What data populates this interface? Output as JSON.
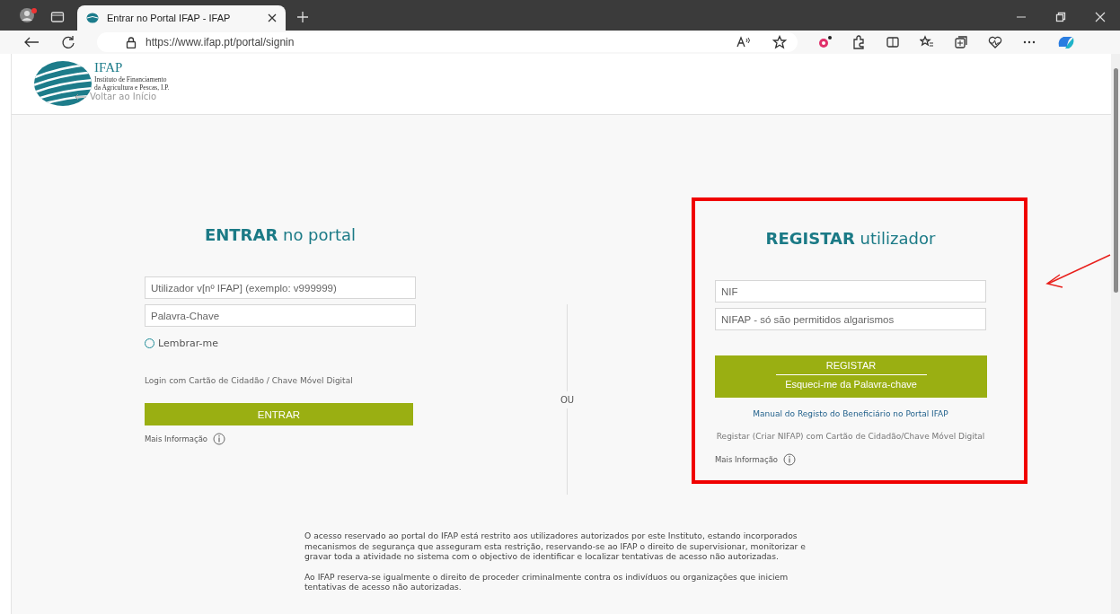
{
  "browser": {
    "tabs": [
      {
        "title": "Entrar no Portal IFAP - IFAP",
        "selected": true
      }
    ],
    "url": "https://www.ifap.pt/portal/signin"
  },
  "header": {
    "logo_title": "IFAP",
    "logo_subtitle": [
      "Instituto de Financiamento",
      "da Agricultura e Pescas, I.P."
    ],
    "back_link": "Voltar ao Início"
  },
  "login": {
    "title": "**ENTRAR** no portal",
    "fields": [
      {
        "placeholder": "Utilizador v[nº IFAP] (exemplo: v999999)"
      },
      {
        "placeholder": "Palavra-Chave"
      }
    ],
    "remember": {
      "label": "Lembrar-me",
      "checked": false
    },
    "citizen_card_link": "Login com Cartão de Cidadão / Chave Móvel Digital",
    "submit": "ENTRAR",
    "more_info": "Mais Informação"
  },
  "separator": "OU",
  "register": {
    "title": "**REGISTAR** utilizador",
    "fields": [
      {
        "placeholder": "NIF"
      },
      {
        "placeholder": "NIFAP - só são permitidos algarismos"
      }
    ],
    "buttons": [
      "REGISTAR",
      "Esqueci-me da Palavra-chave"
    ],
    "manual_link": "Manual do Registo do Beneficiário no Portal IFAP",
    "citizen_card_link": "Registar (Criar NIFAP) com Cartão de Cidadão/Chave Móvel Digital",
    "more_info": "Mais Informação"
  },
  "notice": [
    "O acesso reservado ao portal do IFAP está restrito aos utilizadores autorizados por este Instituto, estando incorporados mecanismos de segurança que asseguram esta restrição, reservando-se ao IFAP o direito de supervisionar, monitorizar e gravar toda a atividade no sistema com o objectivo de identificar e localizar tentativas de acesso não autorizadas.",
    "Ao IFAP reserva-se igualmente o direito de proceder criminalmente contra os indivíduos ou organizações que iniciem tentativas de acesso não autorizadas."
  ]
}
